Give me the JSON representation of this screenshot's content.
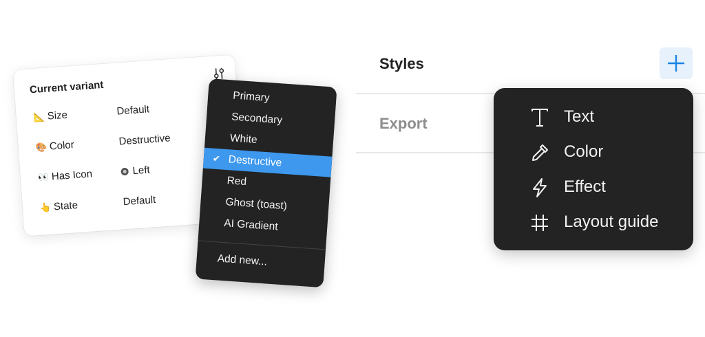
{
  "variant_card": {
    "title": "Current variant",
    "tune_icon": "sliders-icon",
    "properties": [
      {
        "emoji": "📐",
        "label": "Size",
        "value": "Default"
      },
      {
        "emoji": "🎨",
        "label": "Color",
        "value": "Destructive"
      },
      {
        "emoji": "👀",
        "label": "Has Icon",
        "value": "Left",
        "value_icon": "radio-icon"
      },
      {
        "emoji": "👆",
        "label": "State",
        "value": "Default"
      }
    ]
  },
  "variant_menu": {
    "items": [
      "Primary",
      "Secondary",
      "White",
      "Destructive",
      "Red",
      "Ghost (toast)",
      "AI Gradient"
    ],
    "selected": "Destructive",
    "selected_mark": "✔",
    "add_new": "Add new...",
    "highlight_color": "#3d98ee"
  },
  "panel": {
    "styles_title": "Styles",
    "export_title": "Export",
    "add_button_icon": "plus-icon",
    "accent": "#1a84e5"
  },
  "styles_menu": {
    "items": [
      {
        "label": "Text",
        "icon": "text-icon"
      },
      {
        "label": "Color",
        "icon": "eyedropper-icon"
      },
      {
        "label": "Effect",
        "icon": "lightning-icon"
      },
      {
        "label": "Layout guide",
        "icon": "grid-icon"
      }
    ]
  }
}
